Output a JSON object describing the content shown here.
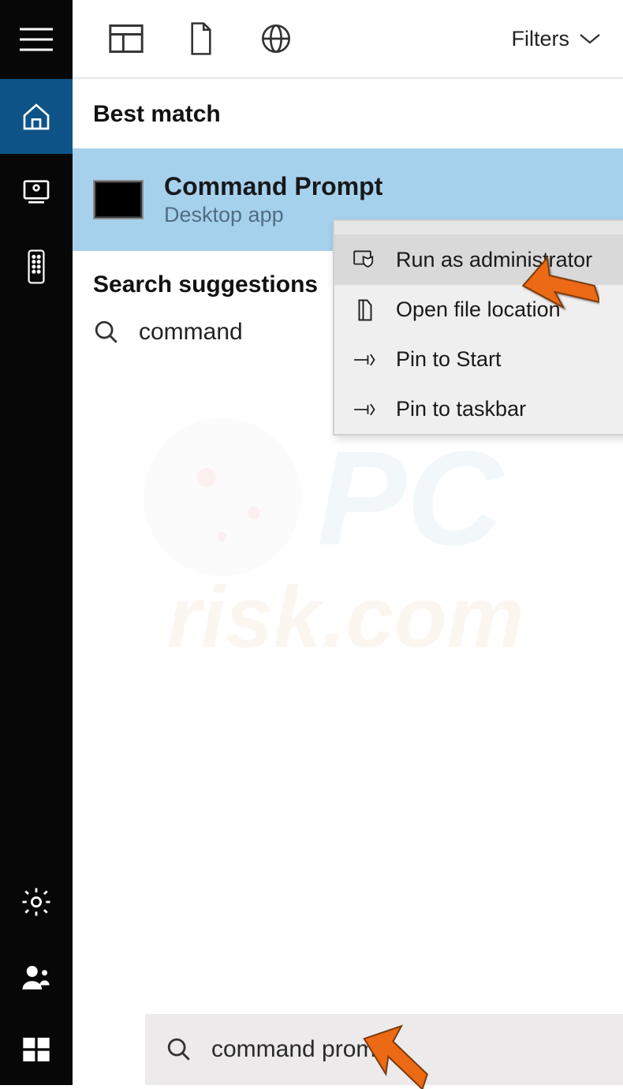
{
  "toolbar": {
    "filters_label": "Filters"
  },
  "sections": {
    "best_match_label": "Best match",
    "suggestions_label": "Search suggestions"
  },
  "best_match": {
    "title": "Command Prompt",
    "subtitle": "Desktop app"
  },
  "suggestion": {
    "text_visible": "command "
  },
  "context_menu": {
    "items": [
      {
        "label": "Run as administrator",
        "icon": "shield-monitor-icon",
        "hover": true
      },
      {
        "label": "Open file location",
        "icon": "folder-open-icon",
        "hover": false
      },
      {
        "label": "Pin to Start",
        "icon": "pin-icon",
        "hover": false
      },
      {
        "label": "Pin to taskbar",
        "icon": "pin-taskbar-icon",
        "hover": false
      }
    ]
  },
  "search": {
    "value": "command prompt"
  },
  "icons": {
    "hamburger": "hamburger-icon",
    "home": "home-icon",
    "monitor": "monitor-icon",
    "remote": "remote-icon",
    "settings": "gear-icon",
    "account": "user-icon",
    "start": "windows-start-icon",
    "apps": "apps-icon",
    "documents": "document-icon",
    "web": "globe-icon",
    "search": "search-icon",
    "chevron_down": "chevron-down-icon",
    "chevron_right": "chevron-right-icon"
  },
  "colors": {
    "sidebar": "#070707",
    "active": "#0d5388",
    "highlight": "#a6d1ed",
    "menu_hover": "#d9d9d9"
  },
  "watermark_text": "PCrisk.com"
}
